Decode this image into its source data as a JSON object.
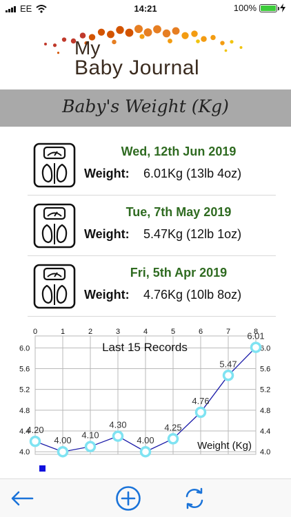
{
  "status_bar": {
    "carrier": "EE",
    "time": "14:21",
    "battery": "100%",
    "battery_level": 1.0
  },
  "logo": {
    "line1": "My",
    "line2": "Baby Journal"
  },
  "page_title": "Baby's Weight (Kg)",
  "records": [
    {
      "date": "Wed, 12th Jun 2019",
      "label": "Weight:",
      "value": "6.01Kg (13lb 4oz)"
    },
    {
      "date": "Tue, 7th May 2019",
      "label": "Weight:",
      "value": "5.47Kg (12lb 1oz)"
    },
    {
      "date": "Fri, 5th Apr 2019",
      "label": "Weight:",
      "value": "4.76Kg (10lb 8oz)"
    }
  ],
  "chart_data": {
    "type": "line",
    "title": "Last 15 Records",
    "series_label": "Weight (Kg)",
    "x": [
      0,
      1,
      2,
      3,
      4,
      5,
      6,
      7,
      8
    ],
    "x_ticks": [
      "0",
      "1",
      "2",
      "3",
      "4",
      "5",
      "6",
      "7",
      "8"
    ],
    "y_ticks": [
      "4.0",
      "4.4",
      "4.8",
      "5.2",
      "5.6",
      "6.0"
    ],
    "series": [
      {
        "values": [
          4.2,
          4.0,
          4.1,
          4.3,
          4.0,
          4.25,
          4.76,
          5.47,
          6.01
        ],
        "labels": [
          "4.20",
          "4.00",
          "4.10",
          "4.30",
          "4.00",
          "4.25",
          "4.76",
          "5.47",
          "6.01"
        ]
      }
    ],
    "xlim": [
      0,
      8
    ],
    "ylim": [
      3.95,
      6.15
    ],
    "grid": true,
    "line_color": "#1a1aa8",
    "marker_color": "#7fe3f2"
  },
  "toolbar": {
    "back_icon": "arrow-left-icon",
    "add_icon": "plus-circle-icon",
    "refresh_icon": "refresh-icon"
  },
  "colors": {
    "accent": "#1a73d9",
    "date_green": "#2f6b21",
    "title_band": "#a9a9a9"
  }
}
